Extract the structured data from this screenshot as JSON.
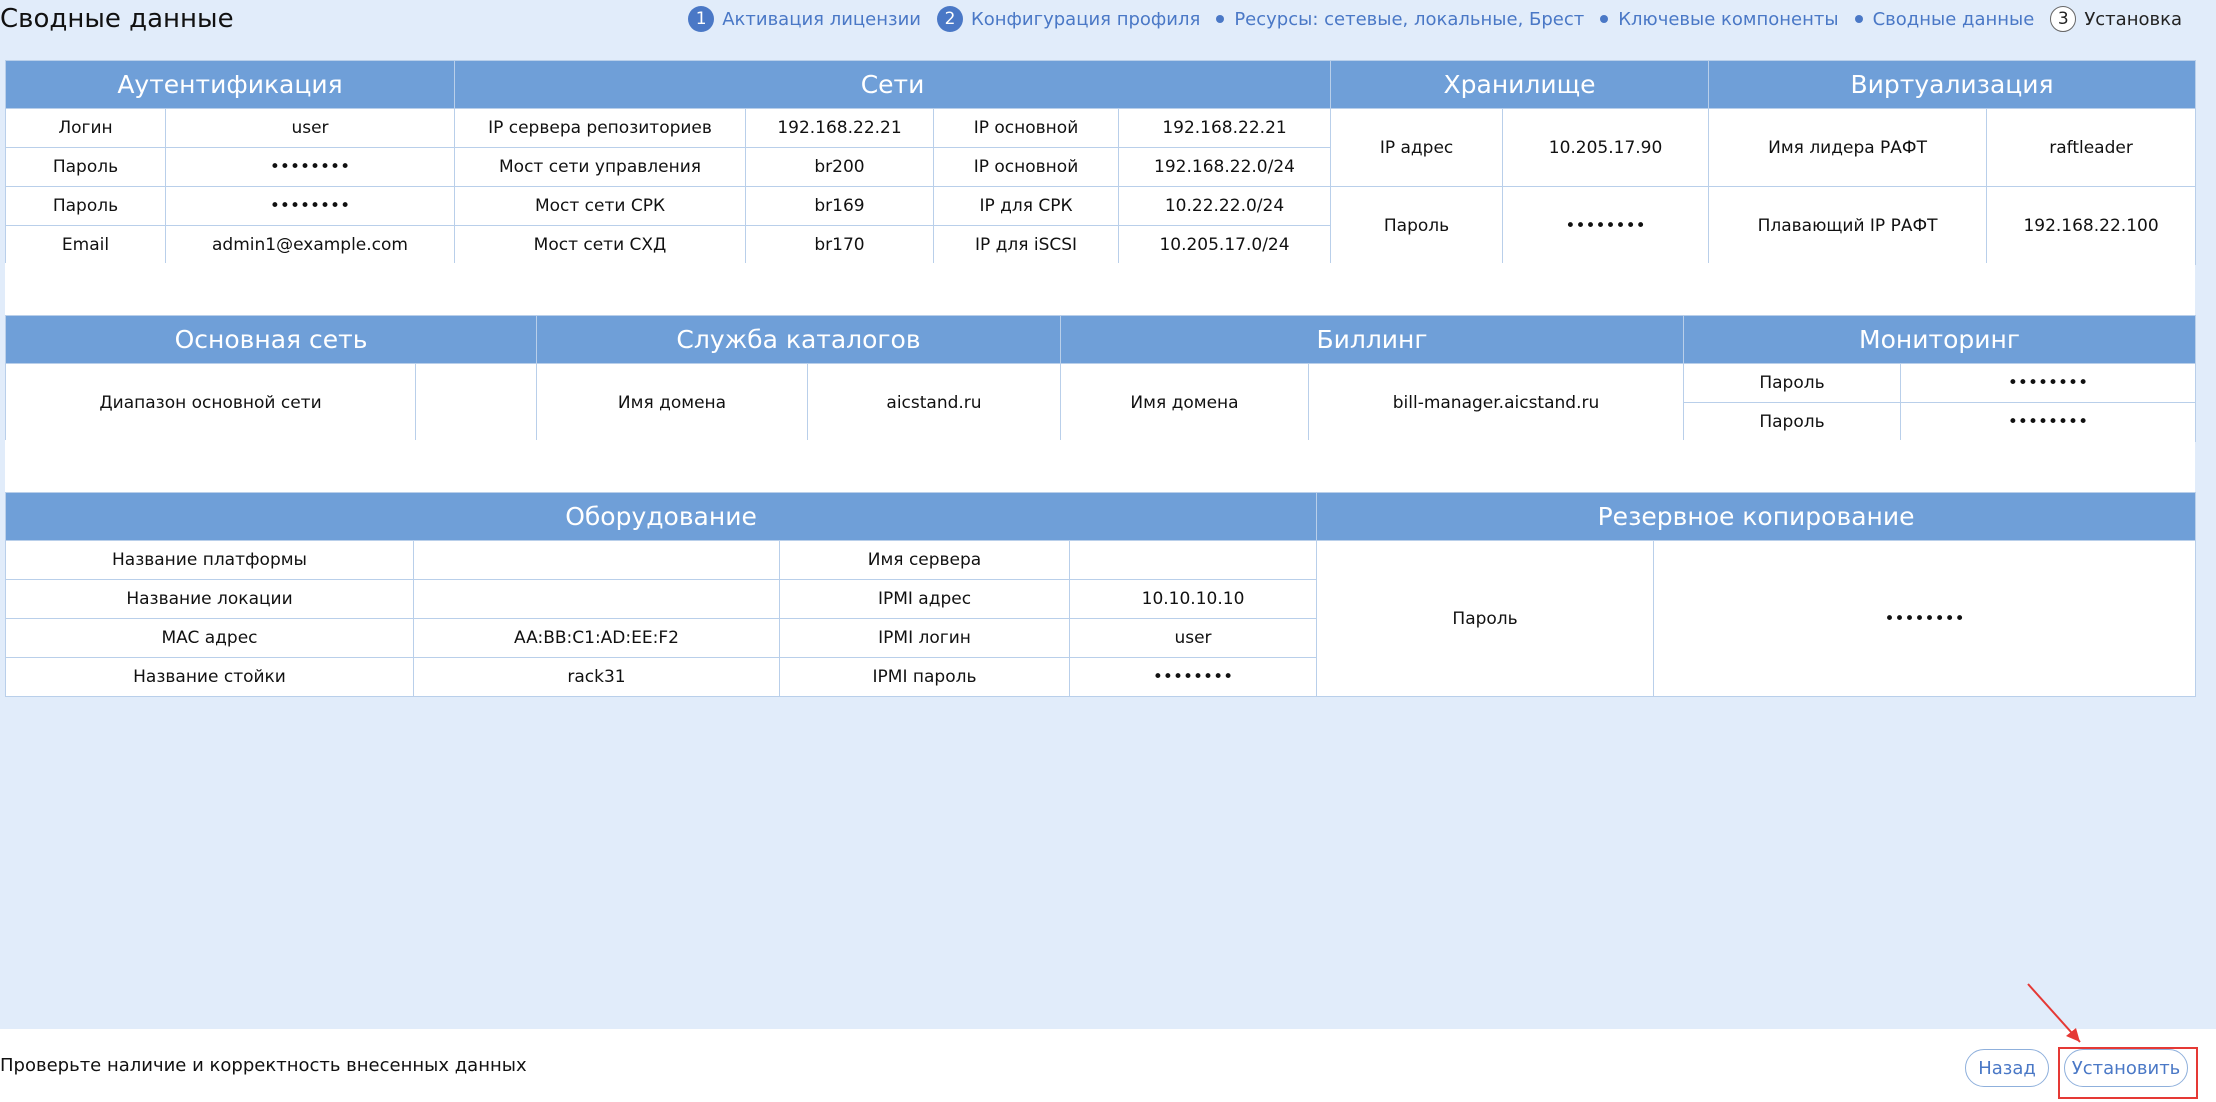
{
  "page": {
    "title": "Сводные данные"
  },
  "steps": [
    {
      "num": "1",
      "label": "Активация лицензии"
    },
    {
      "num": "2",
      "label": "Конфигурация профиля"
    },
    {
      "label": "Ресурсы: сетевые, локальные, Брест"
    },
    {
      "label": "Ключевые компоненты"
    },
    {
      "label": "Сводные данные"
    },
    {
      "num": "3",
      "label": "Установка"
    }
  ],
  "sections": {
    "auth": {
      "title": "Аутентификация",
      "rows": [
        {
          "label": "Логин",
          "value": "user"
        },
        {
          "label": "Пароль",
          "value": "••••••••"
        },
        {
          "label": "Пароль",
          "value": "••••••••"
        },
        {
          "label": "Email",
          "value": "admin1@example.com"
        }
      ]
    },
    "networks": {
      "title": "Сети",
      "rows": [
        {
          "l1": "IP сервера репозиториев",
          "v1": "192.168.22.21",
          "l2": "IP основной",
          "v2": "192.168.22.21"
        },
        {
          "l1": "Мост сети управления",
          "v1": "br200",
          "l2": "IP основной",
          "v2": "192.168.22.0/24"
        },
        {
          "l1": "Мост сети СРК",
          "v1": "br169",
          "l2": "IP для СРК",
          "v2": "10.22.22.0/24"
        },
        {
          "l1": "Мост сети СХД",
          "v1": "br170",
          "l2": "IP для iSCSI",
          "v2": "10.205.17.0/24"
        }
      ]
    },
    "storage": {
      "title": "Хранилище",
      "rows": [
        {
          "label": "IP адрес",
          "value": "10.205.17.90"
        },
        {
          "label": "Пароль",
          "value": "••••••••"
        }
      ]
    },
    "virt": {
      "title": "Виртуализация",
      "rows": [
        {
          "label": "Имя лидера РАФТ",
          "value": "raftleader"
        },
        {
          "label": "Плавающий IP РАФТ",
          "value": "192.168.22.100"
        }
      ]
    },
    "mainnet": {
      "title": "Основная сеть",
      "label": "Диапазон основной сети",
      "value": ""
    },
    "catalog": {
      "title": "Служба каталогов",
      "label": "Имя домена",
      "value": "aicstand.ru"
    },
    "billing": {
      "title": "Биллинг",
      "label": "Имя домена",
      "value": "bill-manager.aicstand.ru"
    },
    "monitoring": {
      "title": "Мониторинг",
      "rows": [
        {
          "label": "Пароль",
          "value": "••••••••"
        },
        {
          "label": "Пароль",
          "value": "••••••••"
        }
      ]
    },
    "hardware": {
      "title": "Оборудование",
      "rows": [
        {
          "l1": "Название платформы",
          "v1": "",
          "l2": "Имя сервера",
          "v2": ""
        },
        {
          "l1": "Название локации",
          "v1": "",
          "l2": "IPMI адрес",
          "v2": "10.10.10.10"
        },
        {
          "l1": "MAC адрес",
          "v1": "AA:BB:C1:AD:EE:F2",
          "l2": "IPMI логин",
          "v2": "user"
        },
        {
          "l1": "Название стойки",
          "v1": "rack31",
          "l2": "IPMI пароль",
          "v2": "••••••••"
        }
      ]
    },
    "backup": {
      "title": "Резервное копирование",
      "label": "Пароль",
      "value": "••••••••"
    }
  },
  "footer": {
    "message": "Проверьте наличие и корректность внесенных данных",
    "back_label": "Назад",
    "install_label": "Установить"
  },
  "colors": {
    "header": "#6f9fd8",
    "accent": "#4a78c6",
    "background": "#e1ecfa",
    "highlight": "#e53935"
  }
}
